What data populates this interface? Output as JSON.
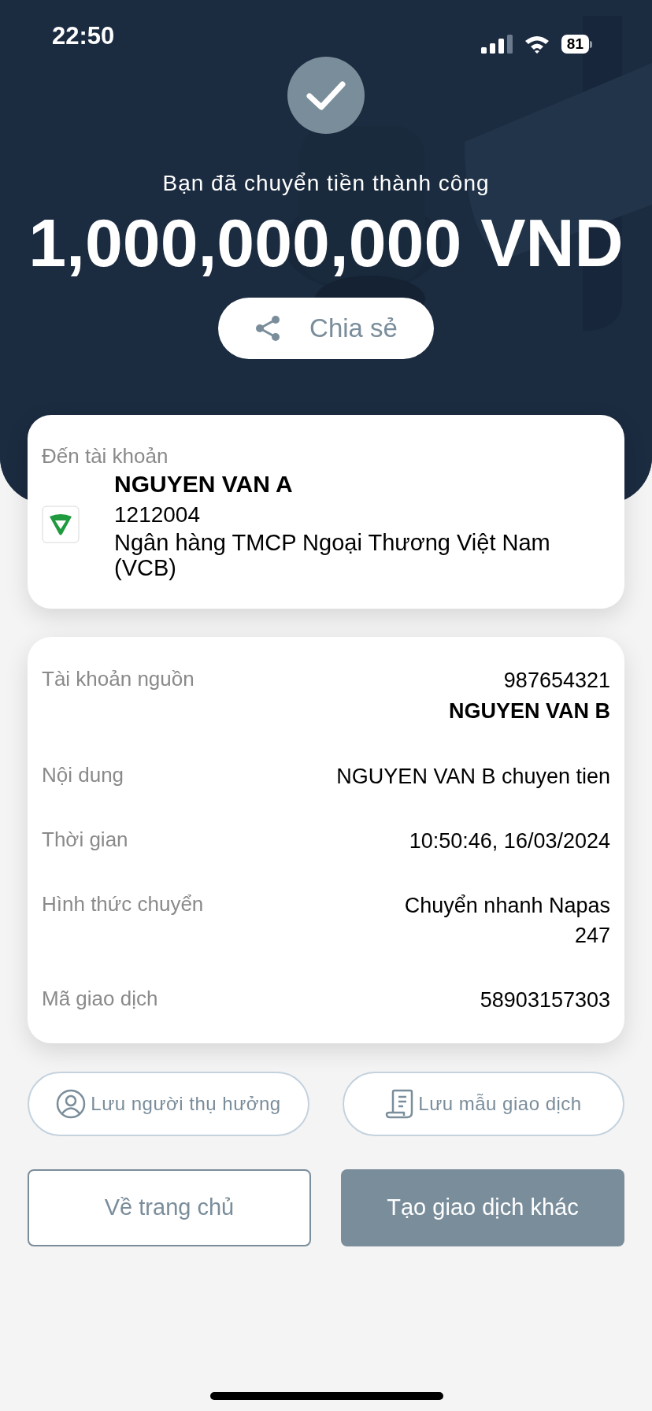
{
  "status_bar": {
    "time": "22:50",
    "battery": "81"
  },
  "success": {
    "message": "Bạn đã chuyển tiền thành công",
    "amount": "1,000,000,000 VND",
    "share_button": "Chia sẻ"
  },
  "recipient": {
    "heading": "Đến tài khoản",
    "name": "NGUYEN VAN A",
    "account": "1212004",
    "bank": "Ngân hàng TMCP Ngoại Thương Việt Nam (VCB)"
  },
  "details": [
    {
      "label": "Tài khoản nguồn",
      "lines": [
        {
          "text": "987654321",
          "bold": false
        },
        {
          "text": "NGUYEN VAN B",
          "bold": true
        }
      ]
    },
    {
      "label": "Nội dung",
      "lines": [
        {
          "text": "NGUYEN VAN B chuyen tien",
          "bold": false
        }
      ]
    },
    {
      "label": "Thời gian",
      "lines": [
        {
          "text": "10:50:46, 16/03/2024",
          "bold": false
        }
      ]
    },
    {
      "label": "Hình thức chuyển",
      "lines": [
        {
          "text": "Chuyển nhanh Napas\n247",
          "bold": false
        }
      ]
    },
    {
      "label": "Mã giao dịch",
      "lines": [
        {
          "text": "58903157303",
          "bold": false
        }
      ]
    }
  ],
  "save_actions": [
    {
      "kind": "beneficiary",
      "label": "Lưu người thụ hưởng"
    },
    {
      "kind": "template",
      "label": "Lưu mẫu giao dịch"
    }
  ],
  "actions": [
    {
      "kind": "secondary",
      "label": "Về trang chủ"
    },
    {
      "kind": "primary",
      "label": "Tạo giao dịch khác"
    }
  ]
}
